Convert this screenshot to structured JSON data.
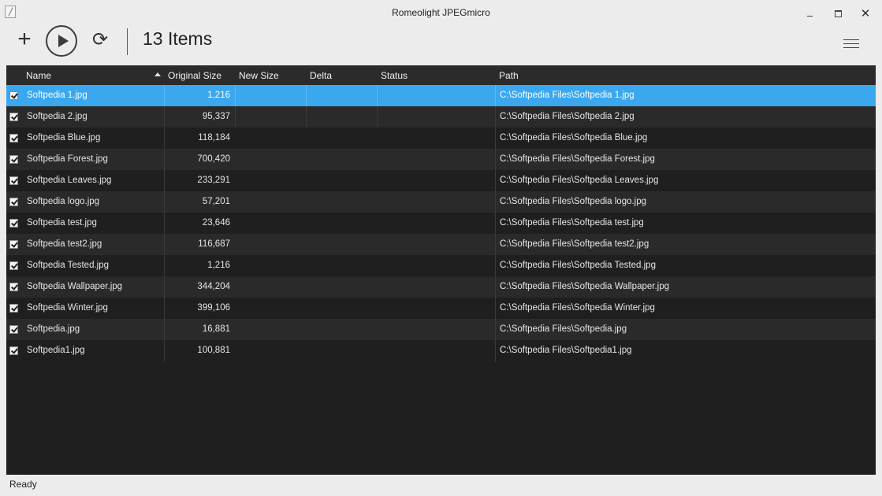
{
  "window": {
    "title": "Romeolight JPEGmicro"
  },
  "toolbar": {
    "items_count": "13 Items"
  },
  "table": {
    "columns": [
      "Name",
      "Original Size",
      "New Size",
      "Delta",
      "Status",
      "Path"
    ],
    "rows": [
      {
        "checked": true,
        "name": "Softpedia 1.jpg",
        "original_size": "1,216",
        "new_size": "",
        "delta": "",
        "status": "",
        "path": "C:\\Softpedia Files\\Softpedia 1.jpg"
      },
      {
        "checked": true,
        "name": "Softpedia 2.jpg",
        "original_size": "95,337",
        "new_size": "",
        "delta": "",
        "status": "",
        "path": "C:\\Softpedia Files\\Softpedia 2.jpg"
      },
      {
        "checked": true,
        "name": "Softpedia Blue.jpg",
        "original_size": "118,184",
        "new_size": "",
        "delta": "",
        "status": "",
        "path": "C:\\Softpedia Files\\Softpedia Blue.jpg"
      },
      {
        "checked": true,
        "name": "Softpedia Forest.jpg",
        "original_size": "700,420",
        "new_size": "",
        "delta": "",
        "status": "",
        "path": "C:\\Softpedia Files\\Softpedia Forest.jpg"
      },
      {
        "checked": true,
        "name": "Softpedia Leaves.jpg",
        "original_size": "233,291",
        "new_size": "",
        "delta": "",
        "status": "",
        "path": "C:\\Softpedia Files\\Softpedia Leaves.jpg"
      },
      {
        "checked": true,
        "name": "Softpedia logo.jpg",
        "original_size": "57,201",
        "new_size": "",
        "delta": "",
        "status": "",
        "path": "C:\\Softpedia Files\\Softpedia logo.jpg"
      },
      {
        "checked": true,
        "name": "Softpedia test.jpg",
        "original_size": "23,646",
        "new_size": "",
        "delta": "",
        "status": "",
        "path": "C:\\Softpedia Files\\Softpedia test.jpg"
      },
      {
        "checked": true,
        "name": "Softpedia test2.jpg",
        "original_size": "116,687",
        "new_size": "",
        "delta": "",
        "status": "",
        "path": "C:\\Softpedia Files\\Softpedia test2.jpg"
      },
      {
        "checked": true,
        "name": "Softpedia Tested.jpg",
        "original_size": "1,216",
        "new_size": "",
        "delta": "",
        "status": "",
        "path": "C:\\Softpedia Files\\Softpedia Tested.jpg"
      },
      {
        "checked": true,
        "name": "Softpedia Wallpaper.jpg",
        "original_size": "344,204",
        "new_size": "",
        "delta": "",
        "status": "",
        "path": "C:\\Softpedia Files\\Softpedia Wallpaper.jpg"
      },
      {
        "checked": true,
        "name": "Softpedia Winter.jpg",
        "original_size": "399,106",
        "new_size": "",
        "delta": "",
        "status": "",
        "path": "C:\\Softpedia Files\\Softpedia Winter.jpg"
      },
      {
        "checked": true,
        "name": "Softpedia.jpg",
        "original_size": "16,881",
        "new_size": "",
        "delta": "",
        "status": "",
        "path": "C:\\Softpedia Files\\Softpedia.jpg"
      },
      {
        "checked": true,
        "name": "Softpedia1.jpg",
        "original_size": "100,881",
        "new_size": "",
        "delta": "",
        "status": "",
        "path": "C:\\Softpedia Files\\Softpedia1.jpg"
      }
    ]
  },
  "status_bar": {
    "text": "Ready"
  },
  "colors": {
    "selected_row": "#3aa7ef",
    "grid_background": "#1f1f1f",
    "alt_row": "#2a2a2a",
    "header_background": "#2b2b2b"
  },
  "icons": [
    "app-icon",
    "add-icon",
    "play-icon",
    "refresh-icon",
    "hamburger-menu-icon",
    "minimize-icon",
    "maximize-icon",
    "close-icon",
    "sort-ascending-icon",
    "checkbox-icon"
  ]
}
